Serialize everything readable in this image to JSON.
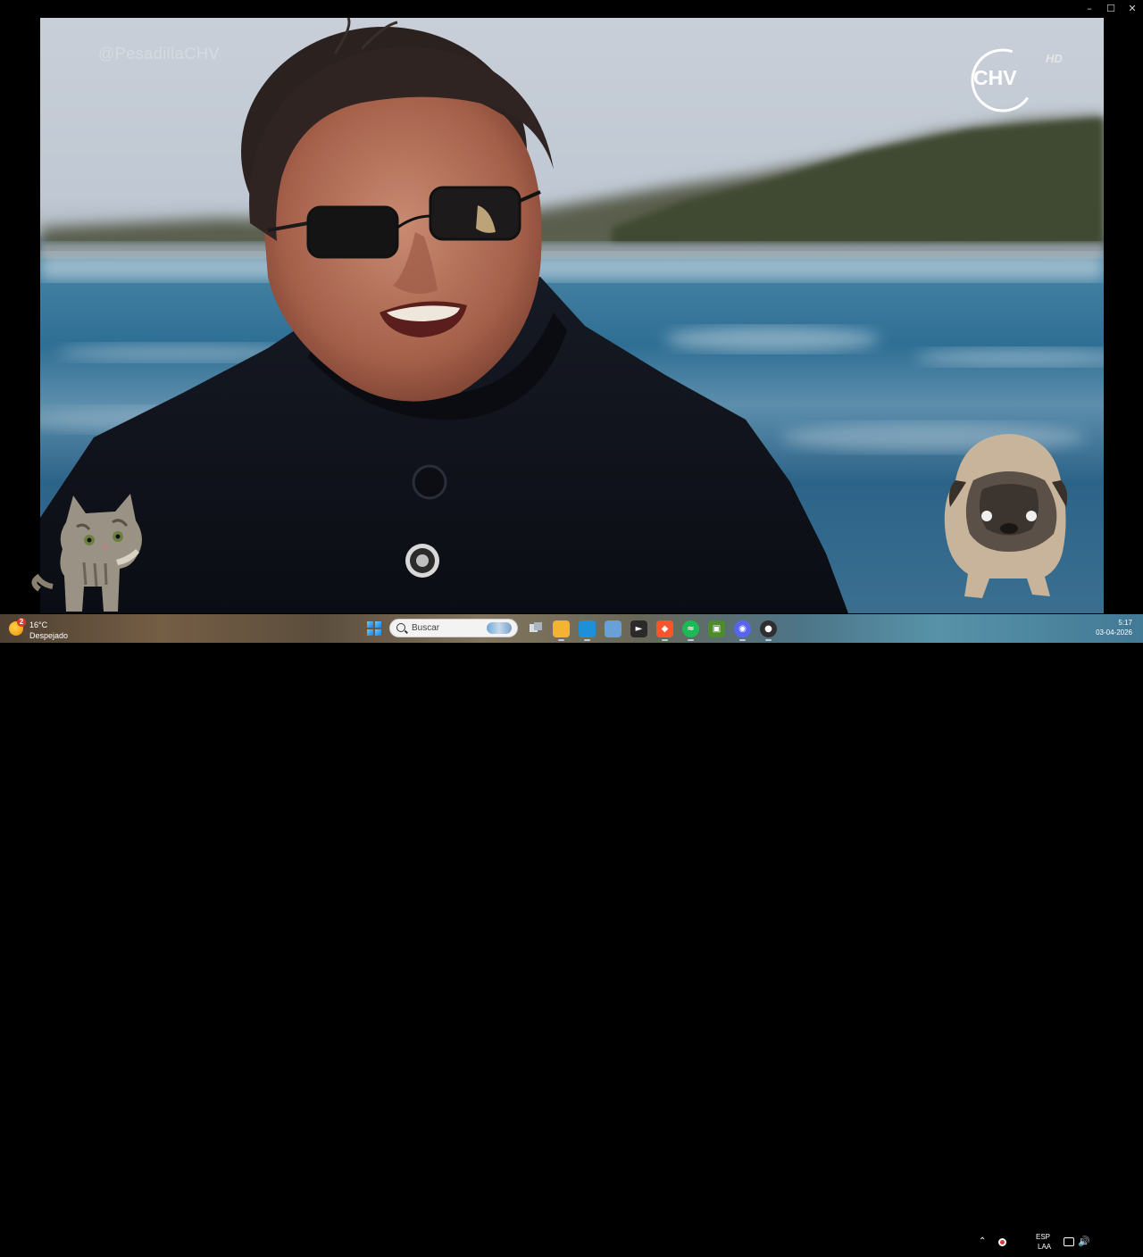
{
  "window": {
    "controls": {
      "minimize": "–",
      "maximize": "☐",
      "close": "✕"
    }
  },
  "video": {
    "watermark": "@PesadillaCHV",
    "channel_logo": {
      "name": "CHV",
      "badge": "HD"
    }
  },
  "desktop_pets": [
    "cat",
    "pug"
  ],
  "taskbar": {
    "weather": {
      "notification_count": "2",
      "temperature": "16°C",
      "condition": "Despejado"
    },
    "search": {
      "placeholder": "Buscar"
    },
    "pinned_apps": [
      {
        "name": "File Explorer",
        "icon": "folder-icon",
        "color": "#f2b431"
      },
      {
        "name": "Microsoft Edge",
        "icon": "edge-icon",
        "color": "#1e90d8"
      },
      {
        "name": "Microsoft Store",
        "icon": "store-icon",
        "color": "#6aa0d8"
      },
      {
        "name": "Terminal",
        "icon": "terminal-icon",
        "color": "#2a2a2a"
      },
      {
        "name": "Brave",
        "icon": "brave-icon",
        "color": "#fb542b"
      },
      {
        "name": "Spotify",
        "icon": "spotify-icon",
        "color": "#1db954"
      },
      {
        "name": "Minecraft",
        "icon": "minecraft-icon",
        "color": "#4e8c2a"
      },
      {
        "name": "Discord",
        "icon": "discord-icon",
        "color": "#5865f2"
      },
      {
        "name": "OBS",
        "icon": "obs-icon",
        "color": "#302e31"
      }
    ],
    "tray": {
      "language_line1": "ESP",
      "language_line2": "LAA",
      "time": "5:17",
      "date": "03-04-2026"
    }
  }
}
